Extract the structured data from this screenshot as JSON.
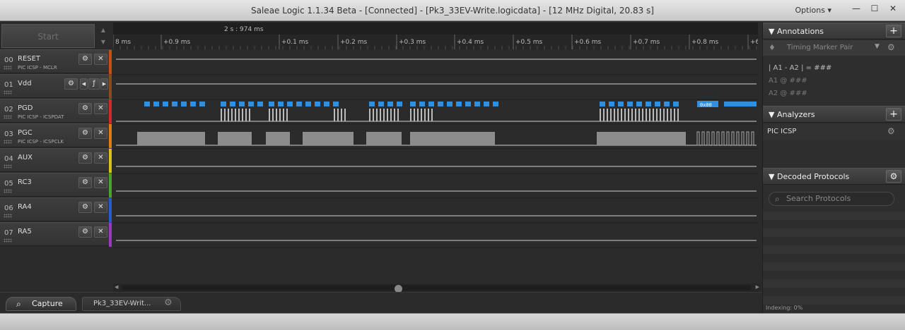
{
  "window": {
    "title": "Saleae Logic 1.1.34 Beta - [Connected] - [Pk3_33EV-Write.logicdata] - [12 MHz Digital, 20.83 s]",
    "options_label": "Options",
    "minimize": "—",
    "maximize": "☐",
    "close": "✕"
  },
  "controls": {
    "start_label": "Start"
  },
  "timeline": {
    "cursor_time": "2 s : 974 ms",
    "ticks": [
      "8 ms",
      "+0.9 ms",
      "+0.1 ms",
      "+0.2 ms",
      "+0.3 ms",
      "+0.4 ms",
      "+0.5 ms",
      "+0.6 ms",
      "+0.7 ms",
      "+0.8 ms",
      "+6"
    ]
  },
  "channels": [
    {
      "num": "00",
      "name": "RESET",
      "sub": "PIC ICSP - MCLR",
      "color": "#c8500f"
    },
    {
      "num": "01",
      "name": "Vdd",
      "sub": "",
      "color": "#8a4a20"
    },
    {
      "num": "02",
      "name": "PGD",
      "sub": "PIC ICSP - ICSPDAT",
      "color": "#d02a2a"
    },
    {
      "num": "03",
      "name": "PGC",
      "sub": "PIC ICSP - ICSPCLK",
      "color": "#e07c10"
    },
    {
      "num": "04",
      "name": "AUX",
      "sub": "",
      "color": "#d8c31a"
    },
    {
      "num": "05",
      "name": "RC3",
      "sub": "",
      "color": "#4aa32a"
    },
    {
      "num": "06",
      "name": "RA4",
      "sub": "",
      "color": "#2a5ad0"
    },
    {
      "num": "07",
      "name": "RA5",
      "sub": "",
      "color": "#9a3ac0"
    }
  ],
  "protocol_label": "0x00",
  "tabs": {
    "capture": "Capture",
    "file": "Pk3_33EV-Writ..."
  },
  "panel": {
    "annotations": {
      "title": "Annotations",
      "marker": "Timing Marker Pair",
      "line1": "| A1 - A2 | = ###",
      "line2": "A1 @ ###",
      "line3": "A2 @ ###"
    },
    "analyzers": {
      "title": "Analyzers",
      "item": "PIC ICSP"
    },
    "decoded": {
      "title": "Decoded Protocols",
      "search_placeholder": "Search Protocols"
    },
    "indexing": "Indexing: 0%"
  }
}
